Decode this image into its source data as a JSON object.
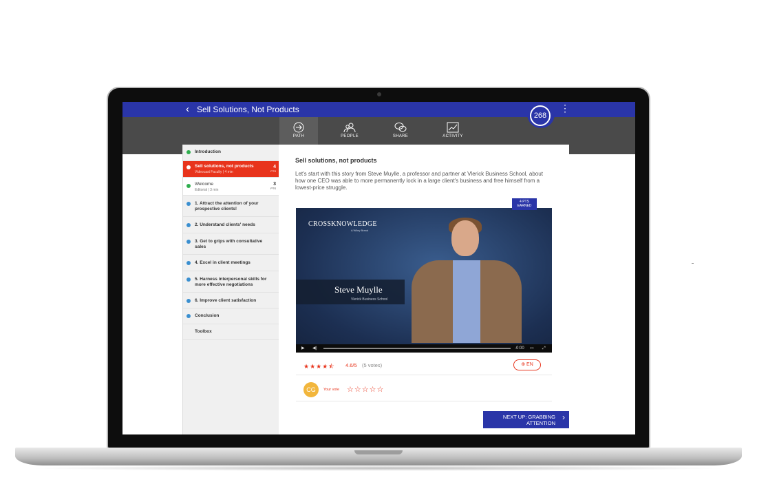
{
  "header": {
    "title": "Sell Solutions, Not Products",
    "score": "268"
  },
  "nav": {
    "tabs": [
      {
        "label": "PATH",
        "icon": "arrow-circle-icon",
        "active": true
      },
      {
        "label": "PEOPLE",
        "icon": "people-icon",
        "active": false
      },
      {
        "label": "SHARE",
        "icon": "chat-bubbles-icon",
        "active": false
      },
      {
        "label": "ACTIVITY",
        "icon": "activity-chart-icon",
        "active": false
      }
    ]
  },
  "sidebar": {
    "items": [
      {
        "label": "Introduction",
        "status": "done"
      },
      {
        "label": "Sell solutions, not products",
        "sub": "Videocast Faculty | 4 min",
        "pts": "4",
        "pts_unit": "PTS",
        "status": "current"
      },
      {
        "label": "Welcome",
        "sub": "Editorial | 3 min",
        "pts": "3",
        "pts_unit": "PTS",
        "status": "done"
      },
      {
        "label": "1. Attract the attention of your prospective clients!",
        "status": "partial"
      },
      {
        "label": "2. Understand clients' needs",
        "status": "partial"
      },
      {
        "label": "3. Get to grips with consultative sales",
        "status": "partial"
      },
      {
        "label": "4. Excel in client meetings",
        "status": "partial"
      },
      {
        "label": "5. Harness interpersonal skills for more effective negotiations",
        "status": "partial"
      },
      {
        "label": "6. Improve client satisfaction",
        "status": "partial"
      },
      {
        "label": "Conclusion",
        "status": "partial"
      },
      {
        "label": "Toolbox",
        "status": "none"
      }
    ]
  },
  "main": {
    "heading": "Sell solutions, not products",
    "intro": "Let's start with this story from Steve Muylle, a professor and partner at Vlerick Business School, about how one CEO was able to more permanently lock in a large client's business and free himself from a lowest-price struggle.",
    "video": {
      "logo": "CROSSKNOWLEDGE",
      "logo_sub": "A Wiley Brand",
      "speaker_name": "Steve Muylle",
      "speaker_org": "Vlerick Business School",
      "time": "-0:00",
      "badge_line1": "4 PTS",
      "badge_line2": "EARNED"
    },
    "rating": {
      "stars": "★★★★⯪",
      "value": "4.6/5",
      "votes": "(5 votes)",
      "lang": "EN"
    },
    "vote": {
      "avatar": "CG",
      "label": "Your vote",
      "stars": "☆☆☆☆☆"
    },
    "next_button": "NEXT UP: GRABBING ATTENTION"
  },
  "colors": {
    "brand_blue": "#2a35a8",
    "accent_red": "#e8341c",
    "done_green": "#2fae4e",
    "partial_blue": "#3a8fd0"
  }
}
